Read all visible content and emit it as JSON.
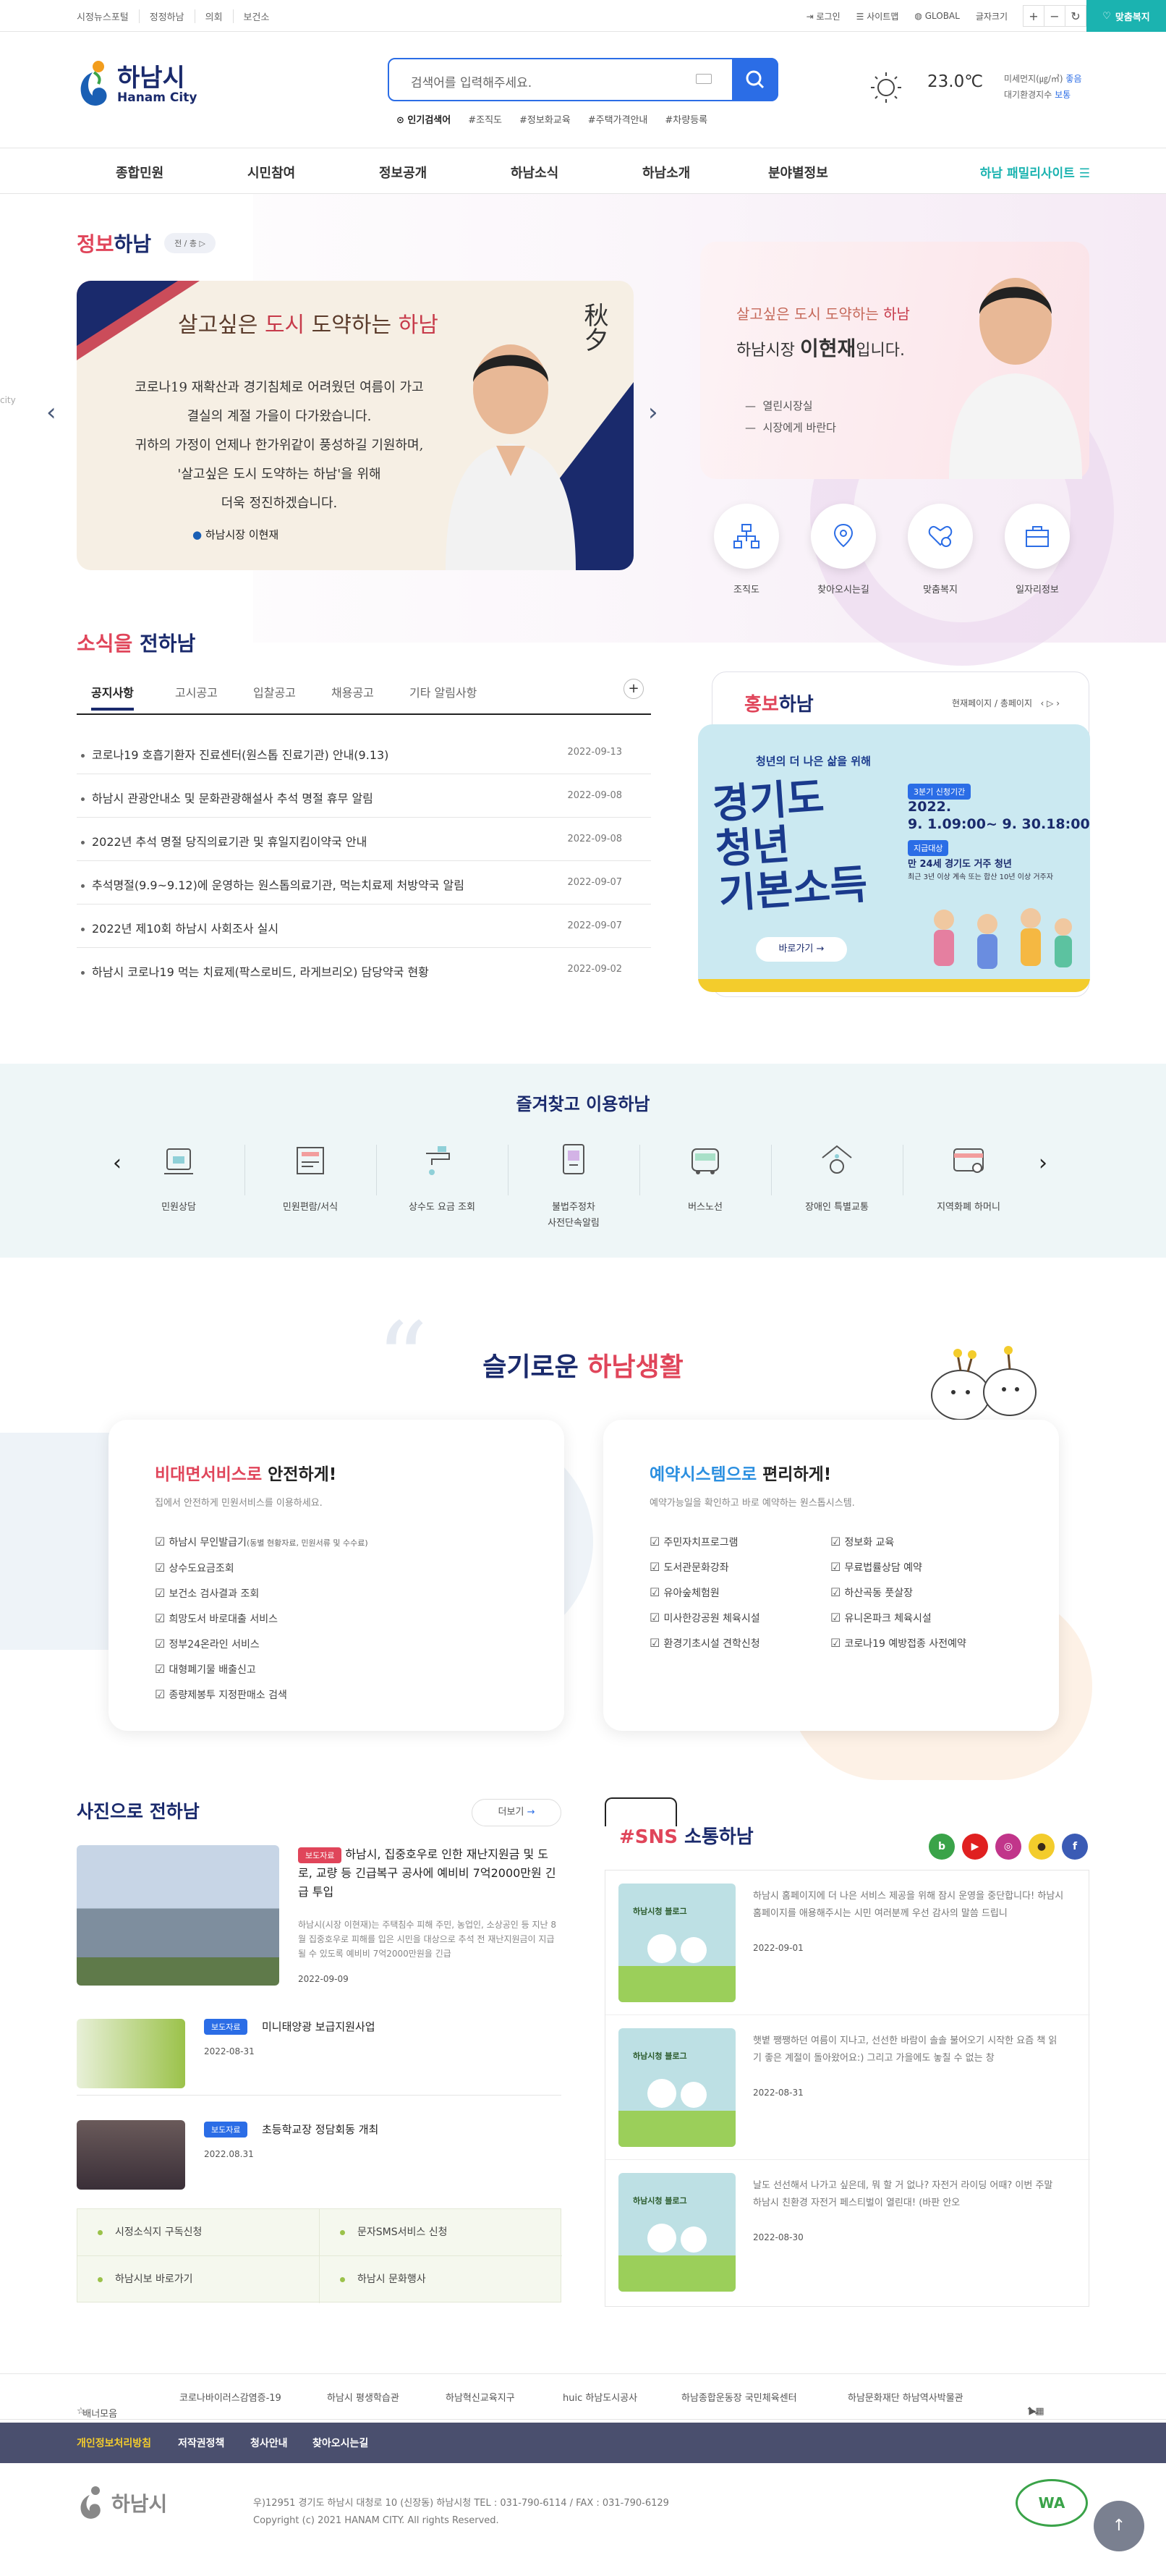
{
  "topbar": {
    "links": [
      "시정뉴스포털",
      "정정하남",
      "의회",
      "보건소"
    ],
    "login": "로그인",
    "sitemap": "사이트맵",
    "global": "GLOBAL",
    "font_size": "글자크기",
    "custom_welfare": "맞춤복지"
  },
  "header": {
    "logo_ko": "하남시",
    "logo_en": "Hanam City",
    "search_placeholder": "검색어를 입력해주세요.",
    "popular_label": "인기검색어",
    "tags": [
      "#조직도",
      "#정보화교육",
      "#주택가격안내",
      "#차량등록"
    ],
    "temp": "23.0℃",
    "dust1_label": "미세먼지(㎍/㎥)",
    "dust1_value": "좋음",
    "dust2_label": "대기환경지수",
    "dust2_value": "보통"
  },
  "gnb": {
    "items": [
      "종합민원",
      "시민참여",
      "정보공개",
      "하남소식",
      "하남소개",
      "분야별정보"
    ],
    "family": "하남 패밀리사이트"
  },
  "info": {
    "title_a": "정보",
    "title_b": "하남",
    "pager": "전 / 총",
    "banner_title_a": "살고싶은 ",
    "banner_title_b": "도시",
    "banner_title_c": " 도약하는 ",
    "banner_title_d": "하남",
    "banner_lines": [
      "코로나19 재확산과 경기침체로 어려웠던 여름이 가고",
      "결실의 계절 가을이 다가왔습니다.",
      "귀하의 가정이 언제나 한가위같이 풍성하길 기원하며,",
      "'살고싶은 도시 도약하는 하남'을 위해",
      "더욱 정진하겠습니다."
    ],
    "banner_sign": "하남시장  이현재",
    "banner_side": "秋夕",
    "left_ghost": "city"
  },
  "mayor": {
    "slogan_a": "살고싶은 도시 도약하는 ",
    "slogan_b": "하남",
    "name_a": "하남시장 ",
    "name_b": "이현재",
    "name_c": "입니다.",
    "list": [
      "열린시장실",
      "시장에게 바란다"
    ]
  },
  "quick": [
    "조직도",
    "찾아오시는길",
    "맞춤복지",
    "일자리정보"
  ],
  "news": {
    "title_a": "소식을",
    "title_b": " 전하남",
    "tabs": [
      "공지사항",
      "고시공고",
      "입찰공고",
      "채용공고",
      "기타 알림사항"
    ],
    "rows": [
      {
        "t": "코로나19 호흡기환자 진료센터(원스톱 진료기관) 안내(9.13)",
        "d": "2022-09-13"
      },
      {
        "t": "하남시 관광안내소 및 문화관광해설사 추석 명절 휴무 알림",
        "d": "2022-09-08"
      },
      {
        "t": "2022년 추석 명절 당직의료기관 및 휴일지킴이약국 안내",
        "d": "2022-09-08"
      },
      {
        "t": "추석명절(9.9~9.12)에 운영하는 원스톱의료기관, 먹는치료제 처방약국 알림",
        "d": "2022-09-07"
      },
      {
        "t": "2022년 제10회 하남시 사회조사 실시",
        "d": "2022-09-07"
      },
      {
        "t": "하남시 코로나19 먹는 치료제(팍스로비드, 라게브리오) 담당약국 현황",
        "d": "2022-09-02"
      }
    ]
  },
  "promo": {
    "title_a": "홍보",
    "title_b": "하남",
    "pager": "현재페이지 / 총페이지",
    "top_text": "청년의 더 나은 삶을 위해",
    "big": [
      "경기도",
      "청년",
      "기본소득"
    ],
    "period_label": "3분기 신청기간",
    "period": "2022.",
    "period2": "9. 1.09:00~ 9. 30.18:00",
    "target_label": "지급대상",
    "target": "만 24세 경기도 거주 청년",
    "target2": "최근 3년 이상 계속 또는 합산 10년 이상 거주자",
    "go": "바로가기"
  },
  "fav": {
    "title": "즐겨찾고 이용하남",
    "items": [
      "민원상담",
      "민원편람/서식",
      "상수도 요금 조회",
      "불법주정차\n사전단속알림",
      "버스노선",
      "장애인 특별교통",
      "지역화폐 하머니"
    ]
  },
  "life": {
    "title_a": "슬기로운 ",
    "title_b": "하남생활",
    "left_h_a": "비대면서비스로",
    "left_h_b": " 안전하게!",
    "left_sub": "집에서 안전하게 민원서비스를 이용하세요.",
    "left_list": [
      "하남시 무인발급기(동별 현황자료, 민원서류 및 수수료)",
      "상수도요금조회",
      "보건소 검사결과 조회",
      "희망도서 바로대출 서비스",
      "정부24온라인 서비스",
      "대형폐기물 배출신고",
      "종량제봉투 지정판매소 검색"
    ],
    "right_h_a": "예약시스템으로",
    "right_h_b": " 편리하게!",
    "right_sub": "예약가능일을 확인하고 바로 예약하는 원스톱시스템.",
    "right_col1": [
      "주민자치프로그램",
      "도서관문화강좌",
      "유아숲체험원",
      "미사한강공원 체육시설",
      "환경기초시설 견학신청"
    ],
    "right_col2": [
      "정보화 교육",
      "무료법률상담 예약",
      "하산곡동 풋살장",
      "유니온파크 체육시설",
      "코로나19 예방접종 사전예약"
    ]
  },
  "photo": {
    "title": "사진으로 전하남",
    "more": "더보기",
    "main_badge": "보도자료",
    "main_title": "하남시, 집중호우로 인한 재난지원금 및 도로, 교량 등 긴급복구 공사에 예비비 7억2000만원 긴급 투입",
    "main_desc": "하남시(시장 이현재)는 주택침수 피해 주민, 농업인, 소상공인 등 지난 8월 집중호우로 피해를 입은 시민을 대상으로 추석 전 재난지원금이 지급될 수 있도록 예비비 7억2000만원을 긴급",
    "main_date": "2022-09-09",
    "items": [
      {
        "badge": "보도자료",
        "title": "미니태양광 보급지원사업",
        "date": "2022-08-31"
      },
      {
        "badge": "보도자료",
        "title": "초등학교장 정담회동 개최",
        "date": "2022.08.31"
      }
    ],
    "links": [
      "시정소식지 구독신청",
      "문자SMS서비스 신청",
      "하남시보 바로가기",
      "하남시 문화행사"
    ]
  },
  "sns": {
    "title_a": "#SNS",
    "title_b": " 소통하남",
    "icons": [
      "b",
      "▶",
      "◎",
      "●",
      "f"
    ],
    "rows": [
      {
        "text": "하남시 홈페이지에 더 나은 서비스 제공을 위해 잠시 운영을 중단합니다! 하남시 홈페이지를 애용해주시는 시민 여러분께 우선 감사의 말씀 드립니",
        "date": "2022-09-01"
      },
      {
        "text": "햇볕 쨍쨍하던 여름이 지나고, 선선한 바람이 솔솔 불어오기 시작한 요즘 책 읽기 좋은 계절이 돌아왔어요:) 그리고 가을에도 놓칠 수 없는 창",
        "date": "2022-08-31"
      },
      {
        "text": "날도 선선해서 나가고 싶은데, 뭐 할 거 없나? 자전거 라이딩 어때? 이번 주말 하남시 친환경 자전거 페스티벌이 열린대! (바판 안오",
        "date": "2022-08-30"
      }
    ],
    "thumb_label": "하남시청 블로그"
  },
  "footer": {
    "banner_label": "배너모음",
    "banners": [
      "코로나바이러스감염증-19",
      "하남시 평생학습관",
      "하남혁신교육지구",
      "huic 하남도시공사",
      "하남종합운동장 국민체육센터",
      "하남문화재단 하남역사박물관"
    ],
    "nav": [
      "개인정보처리방침",
      "저작권정책",
      "청사안내",
      "찾아오시는길"
    ],
    "logo": "하남시",
    "address": "우)12951 경기도 하남시 대청로 10 (신장동) 하남시청 TEL : 031-790-6114 / FAX : 031-790-6129",
    "copyright": "Copyright (c) 2021 HANAM CITY. All rights Reserved.",
    "wa_mark": "WA",
    "top": "↑"
  },
  "colors": {
    "accent": "#1bb3b0",
    "navy": "#1a2a6c",
    "red": "#e0455a",
    "blue": "#2b6de6"
  }
}
